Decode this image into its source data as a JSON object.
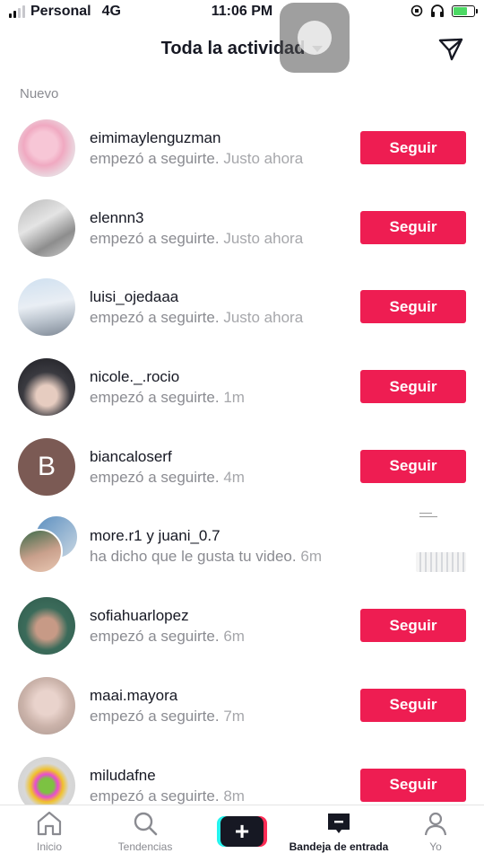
{
  "status_bar": {
    "carrier": "Personal",
    "network": "4G",
    "time": "11:06 PM",
    "signal_bars": 4,
    "signal_active": 2,
    "battery_level": 0.7
  },
  "header": {
    "title": "Toda la actividad",
    "send_icon": "send-icon"
  },
  "section": {
    "label": "Nuevo"
  },
  "colors": {
    "accent": "#ee1d52",
    "muted_text": "#8a8b91"
  },
  "notifications": [
    {
      "name": "eimimaylenguzman",
      "action": "empezó a seguirte.",
      "time": "Justo ahora",
      "button": "Seguir"
    },
    {
      "name": "elennn3",
      "action": "empezó a seguirte.",
      "time": "Justo ahora",
      "button": "Seguir"
    },
    {
      "name": "luisi_ojedaaa",
      "action": "empezó a seguirte.",
      "time": "Justo ahora",
      "button": "Seguir"
    },
    {
      "name": "nicole._.rocio",
      "action": "empezó a seguirte.",
      "time": "1m",
      "button": "Seguir"
    },
    {
      "name": "biancaloserf",
      "avatar_letter": "B",
      "action": "empezó a seguirte.",
      "time": "4m",
      "button": "Seguir"
    },
    {
      "name": "more.r1",
      "joiner": "y",
      "name2": "juani_0.7",
      "action": "ha dicho que le gusta tu video.",
      "time": "6m"
    },
    {
      "name": "sofiahuarlopez",
      "action": "empezó a seguirte.",
      "time": "6m",
      "button": "Seguir"
    },
    {
      "name": "maai.mayora",
      "action": "empezó a seguirte.",
      "time": "7m",
      "button": "Seguir"
    },
    {
      "name": "miludafne",
      "action": "empezó a seguirte.",
      "time": "8m",
      "button": "Seguir"
    }
  ],
  "bottom_nav": [
    {
      "label": "Inicio",
      "icon": "home-icon"
    },
    {
      "label": "Tendencias",
      "icon": "search-icon"
    },
    {
      "label": "",
      "icon": "plus-icon"
    },
    {
      "label": "Bandeja de entrada",
      "icon": "inbox-icon",
      "active": true
    },
    {
      "label": "Yo",
      "icon": "profile-icon"
    }
  ]
}
